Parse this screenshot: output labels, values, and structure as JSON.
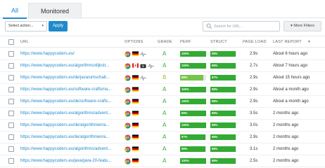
{
  "tabs": [
    {
      "label": "All",
      "active": true
    },
    {
      "label": "Monitored",
      "active": false
    }
  ],
  "toolbar": {
    "select_label": "Select action...",
    "apply_label": "Apply",
    "search_placeholder": "Search for URL...",
    "more_filters_label": "More Filters"
  },
  "columns": {
    "url": "URL",
    "options": "OPTIONS",
    "grade": "GRADE",
    "perf": "PERF",
    "struct": "STRUCT",
    "page_load": "PAGE LOAD",
    "last_report": "LAST REPORT"
  },
  "colors": {
    "accent": "#1f8acb",
    "bar_green": "#33aa33",
    "grade_a": "#3db544",
    "grade_b": "#9fc43a"
  },
  "rows": [
    {
      "url": "https://www.happycoders.eu/",
      "flags": [
        "chrome-icon",
        "de-flag-icon",
        "monitor-pulse-icon"
      ],
      "grade": "A",
      "perf": "100%",
      "perf_v": 1.0,
      "struct": "98%",
      "struct_v": 0.98,
      "load": "2.9s",
      "last": "About 6 hours ago"
    },
    {
      "url": "https://www.happycoders.eu/algorithms/dijkstr...",
      "flags": [
        "chrome-icon",
        "ca-flag-icon",
        "video-icon",
        "monitor-pulse-icon"
      ],
      "grade": "A",
      "perf": "100%",
      "perf_v": 1.0,
      "struct": "98%",
      "struct_v": 0.98,
      "load": "2.7s",
      "last": "About 7 hours ago"
    },
    {
      "url": "https://www.happycoders.eu/de/java/umschalt...",
      "flags": [
        "chrome-icon",
        "de-flag-icon",
        "monitor-pulse-icon"
      ],
      "grade": "B",
      "perf": "88%",
      "perf_v": 0.88,
      "struct": "97%",
      "struct_v": 0.97,
      "load": "2.9s",
      "last": "About 15 hours ago"
    },
    {
      "url": "https://www.happycoders.eu/software-craftsma...",
      "flags": [
        "chrome-icon",
        "de-flag-icon"
      ],
      "grade": "A",
      "perf": "100%",
      "perf_v": 1.0,
      "struct": "98%",
      "struct_v": 0.98,
      "load": "2.9s",
      "last": "About a month ago"
    },
    {
      "url": "https://www.happycoders.eu/de/software-crafts...",
      "flags": [
        "chrome-icon",
        "de-flag-icon"
      ],
      "grade": "A",
      "perf": "100%",
      "perf_v": 1.0,
      "struct": "98%",
      "struct_v": 0.98,
      "load": "2.9s",
      "last": "About a month ago"
    },
    {
      "url": "https://www.happycoders.eu/algorithms/advent...",
      "flags": [
        "chrome-icon",
        "de-flag-icon"
      ],
      "grade": "A",
      "perf": "99%",
      "perf_v": 0.99,
      "struct": "98%",
      "struct_v": 0.98,
      "load": "3.5s",
      "last": "2 months ago"
    },
    {
      "url": "https://www.happycoders.eu/de/algorithmen/a...",
      "flags": [
        "chrome-icon",
        "de-flag-icon"
      ],
      "grade": "A",
      "perf": "100%",
      "perf_v": 1.0,
      "struct": "98%",
      "struct_v": 0.98,
      "load": "3.0s",
      "last": "2 months ago"
    },
    {
      "url": "https://www.happycoders.eu/de/algorithmen/a...",
      "flags": [
        "chrome-icon",
        "de-flag-icon"
      ],
      "grade": "A",
      "perf": "97%",
      "perf_v": 0.97,
      "struct": "98%",
      "struct_v": 0.98,
      "load": "2.9s",
      "last": "2 months ago"
    },
    {
      "url": "https://www.happycoders.eu/algorithms/advent...",
      "flags": [
        "chrome-icon",
        "de-flag-icon"
      ],
      "grade": "A",
      "perf": "98%",
      "perf_v": 0.98,
      "struct": "98%",
      "struct_v": 0.98,
      "load": "3.1s",
      "last": "2 months ago"
    },
    {
      "url": "https://www.happycoders.eu/java/java-20-featu...",
      "flags": [
        "chrome-icon",
        "de-flag-icon"
      ],
      "grade": "A",
      "perf": "100%",
      "perf_v": 1.0,
      "struct": "98%",
      "struct_v": 0.98,
      "load": "2.5s",
      "last": "2 months ago"
    }
  ]
}
